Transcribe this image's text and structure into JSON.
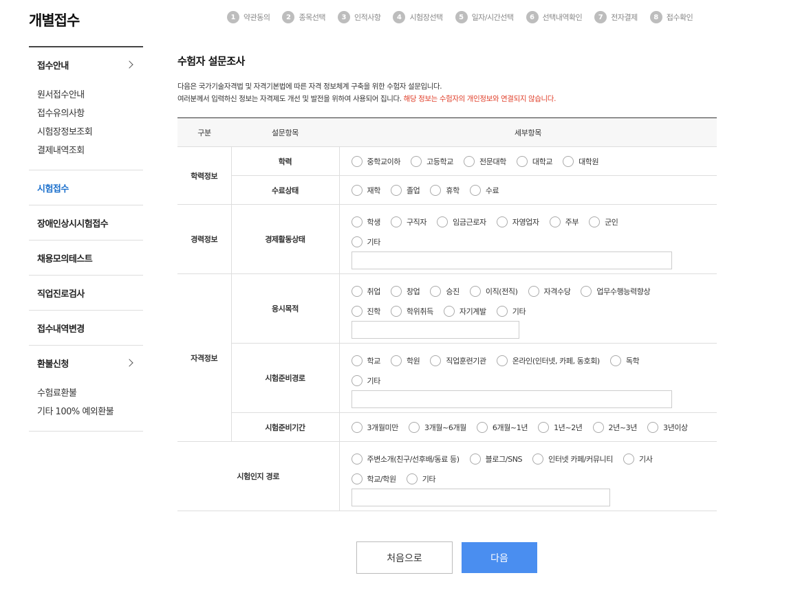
{
  "page_title": "개별접수",
  "steps": [
    {
      "num": "1",
      "label": "약관동의"
    },
    {
      "num": "2",
      "label": "종목선택"
    },
    {
      "num": "3",
      "label": "인적사항"
    },
    {
      "num": "4",
      "label": "시험장선택"
    },
    {
      "num": "5",
      "label": "일자/시간선택"
    },
    {
      "num": "6",
      "label": "선택내역확인"
    },
    {
      "num": "7",
      "label": "전자결제"
    },
    {
      "num": "8",
      "label": "접수확인"
    }
  ],
  "sidebar": {
    "groups": [
      {
        "label": "접수안내",
        "sub": [
          "원서접수안내",
          "접수유의사항",
          "시험장정보조회",
          "결제내역조회"
        ]
      },
      {
        "label": "시험접수"
      },
      {
        "label": "장애인상시시험접수"
      },
      {
        "label": "채용모의테스트"
      },
      {
        "label": "직업진로검사"
      },
      {
        "label": "접수내역변경"
      },
      {
        "label": "환불신청",
        "sub": [
          "수험료환불",
          "기타 100% 예외환불"
        ]
      }
    ]
  },
  "survey": {
    "title": "수험자 설문조사",
    "desc_line1": "다음은 국가기술자격법 및 자격기본법에 따른 자격 정보체계 구축을 위한 수험자 설문입니다.",
    "desc_line2": "여러분께서 입력하신 정보는 자격제도 개선 및 발전을 위하여 사용되어 집니다.",
    "desc_warn": "해당 정보는 수험자의 개인정보와 연결되지 않습니다.",
    "headers": {
      "col1": "구분",
      "col2": "설문항목",
      "col3": "세부항목"
    },
    "cat_education": "학력정보",
    "cat_career": "경력정보",
    "cat_qualification": "자격정보",
    "q_education": {
      "label": "학력",
      "options": [
        "중학교이하",
        "고등학교",
        "전문대학",
        "대학교",
        "대학원"
      ]
    },
    "q_completion": {
      "label": "수료상태",
      "options": [
        "재학",
        "졸업",
        "휴학",
        "수료"
      ]
    },
    "q_employment": {
      "label": "경제활동상태",
      "options_row1": [
        "학생",
        "구직자",
        "임금근로자",
        "자영업자",
        "주부",
        "군인"
      ],
      "options_row2": [
        "기타"
      ]
    },
    "q_purpose": {
      "label": "응시목적",
      "options_row1": [
        "취업",
        "창업",
        "승진",
        "이직(전직)",
        "자격수당",
        "업무수행능력향상"
      ],
      "options_row2": [
        "진학",
        "학위취득",
        "자기계발",
        "기타"
      ]
    },
    "q_prep_path": {
      "label": "시험준비경로",
      "options_row1": [
        "학교",
        "학원",
        "직업훈련기관",
        "온라인(인터넷, 카페, 동호회)",
        "독학"
      ],
      "options_row2": [
        "기타"
      ]
    },
    "q_prep_period": {
      "label": "시험준비기간",
      "options": [
        "3개월미만",
        "3개월~6개월",
        "6개월~1년",
        "1년~2년",
        "2년~3년",
        "3년이상"
      ]
    },
    "q_awareness": {
      "label": "시험인지 경로",
      "options_row1": [
        "주변소개(친구/선후배/동료 등)",
        "블로그/SNS",
        "인터넷 카페/커뮤니티",
        "기사"
      ],
      "options_row2": [
        "학교/학원",
        "기타"
      ]
    }
  },
  "buttons": {
    "first": "처음으로",
    "next": "다음"
  }
}
